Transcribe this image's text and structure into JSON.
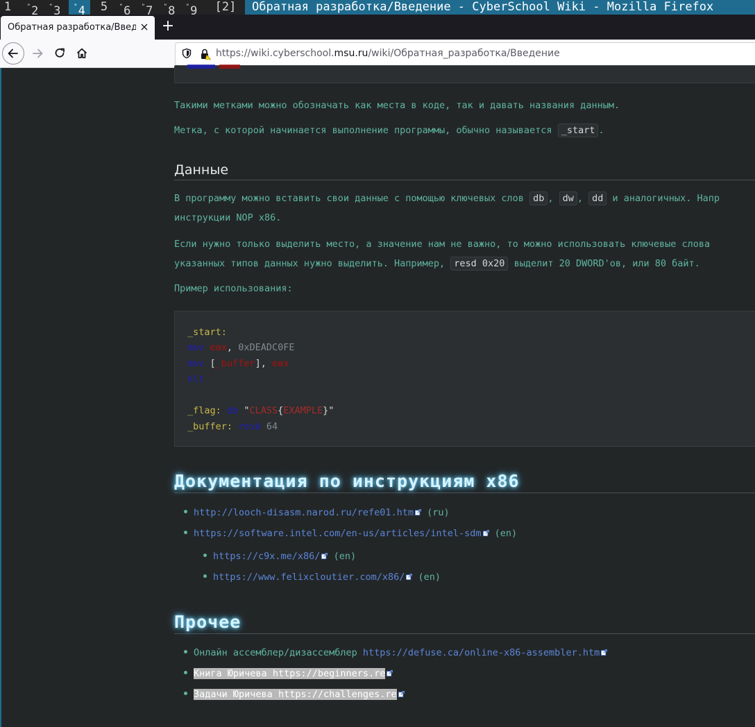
{
  "wm": {
    "workspaces": [
      {
        "num": "1",
        "sup": ""
      },
      {
        "num": "2",
        "sup": "\""
      },
      {
        "num": "3",
        "sup": "\""
      },
      {
        "num": "4",
        "sup": "\""
      },
      {
        "num": "5",
        "sup": ""
      },
      {
        "num": "6",
        "sup": "\""
      },
      {
        "num": "7",
        "sup": "\""
      },
      {
        "num": "8",
        "sup": "\""
      },
      {
        "num": "9",
        "sup": "\""
      },
      {
        "num": "[2]",
        "sup": ""
      }
    ],
    "active_workspace": "4",
    "window_title": "Обратная разработка/Введение - CyberSchool Wiki - Mozilla Firefox"
  },
  "browser": {
    "tab_title": "Обратная разработка/Введение",
    "close_label": "×",
    "newtab_label": "+",
    "url_prefix": "https://wiki.cyberschool.",
    "url_host": "msu.ru",
    "url_path": "/wiki/Обратная_разработка/Введение"
  },
  "article": {
    "para_labels": "Такими метками можно обозначать как места в коде, так и давать названия данным.",
    "para_start_before": "Метка, с которой начинается выполнение программы, обычно называется",
    "para_start_code": "_start",
    "para_start_after": ".",
    "h_data": "Данные",
    "para_data1_a": "В программу можно вставить свои данные с помощью ключевых слов",
    "code_db": "db",
    "code_dw": "dw",
    "code_dd": "dd",
    "para_data1_b": "и аналогичных. Напр",
    "para_data1_line2": "инструкции NOP x86.",
    "para_data2_line1": "Если нужно только выделить место, а значение нам не важно, то можно использовать ключевые слова",
    "para_data2_line2_a": "указанных типов данных нужно выделить. Например,",
    "code_resd": "resd 0x20",
    "para_data2_line2_b": "выделит 20 DWORD'ов, или 80 байт.",
    "para_example": "Пример использования:",
    "code": {
      "l1_label": "_start:",
      "l2_kw": "mov",
      "l2_reg": "eax",
      "l2_sep": ", ",
      "l2_num": "0xDEADC0FE",
      "l3_kw": "mov",
      "l3_open": " [",
      "l3_ref": "_buffer",
      "l3_close": "], ",
      "l3_reg": "eax",
      "l4_kw": "hlt",
      "l5_label": "_flag:",
      "l5_kw": "db",
      "l5_q1": " \"",
      "l5_s1": "CLASS",
      "l5_brace": "{",
      "l5_s2": "EXAMPLE",
      "l5_end": "}\"",
      "l6_label": "_buffer:",
      "l6_kw": "resb",
      "l6_num": "64"
    },
    "h_docs": "Документация по инструкциям x86",
    "docs_links": [
      {
        "url": "http://looch-disasm.narod.ru/refe01.htm",
        "lang": "(ru)"
      },
      {
        "url": "https://software.intel.com/en-us/articles/intel-sdm",
        "lang": "(en)"
      },
      {
        "url": "https://c9x.me/x86/",
        "lang": "(en)"
      },
      {
        "url": "https://www.felixcloutier.com/x86/",
        "lang": "(en)"
      }
    ],
    "h_other": "Прочее",
    "other_1_text": "Онлайн ассемблер/дизассемблер",
    "other_1_url": "https://defuse.ca/online-x86-assembler.htm",
    "other_2_text": "Книга Юричева",
    "other_2_url": "https://beginners.re",
    "other_3_text": "Задачи Юричева",
    "other_3_url": "https://challenges.re"
  },
  "colors": {
    "accent": "#1f6c90",
    "text": "#5fb5a0",
    "link": "#5a86d8",
    "background": "#232627"
  }
}
